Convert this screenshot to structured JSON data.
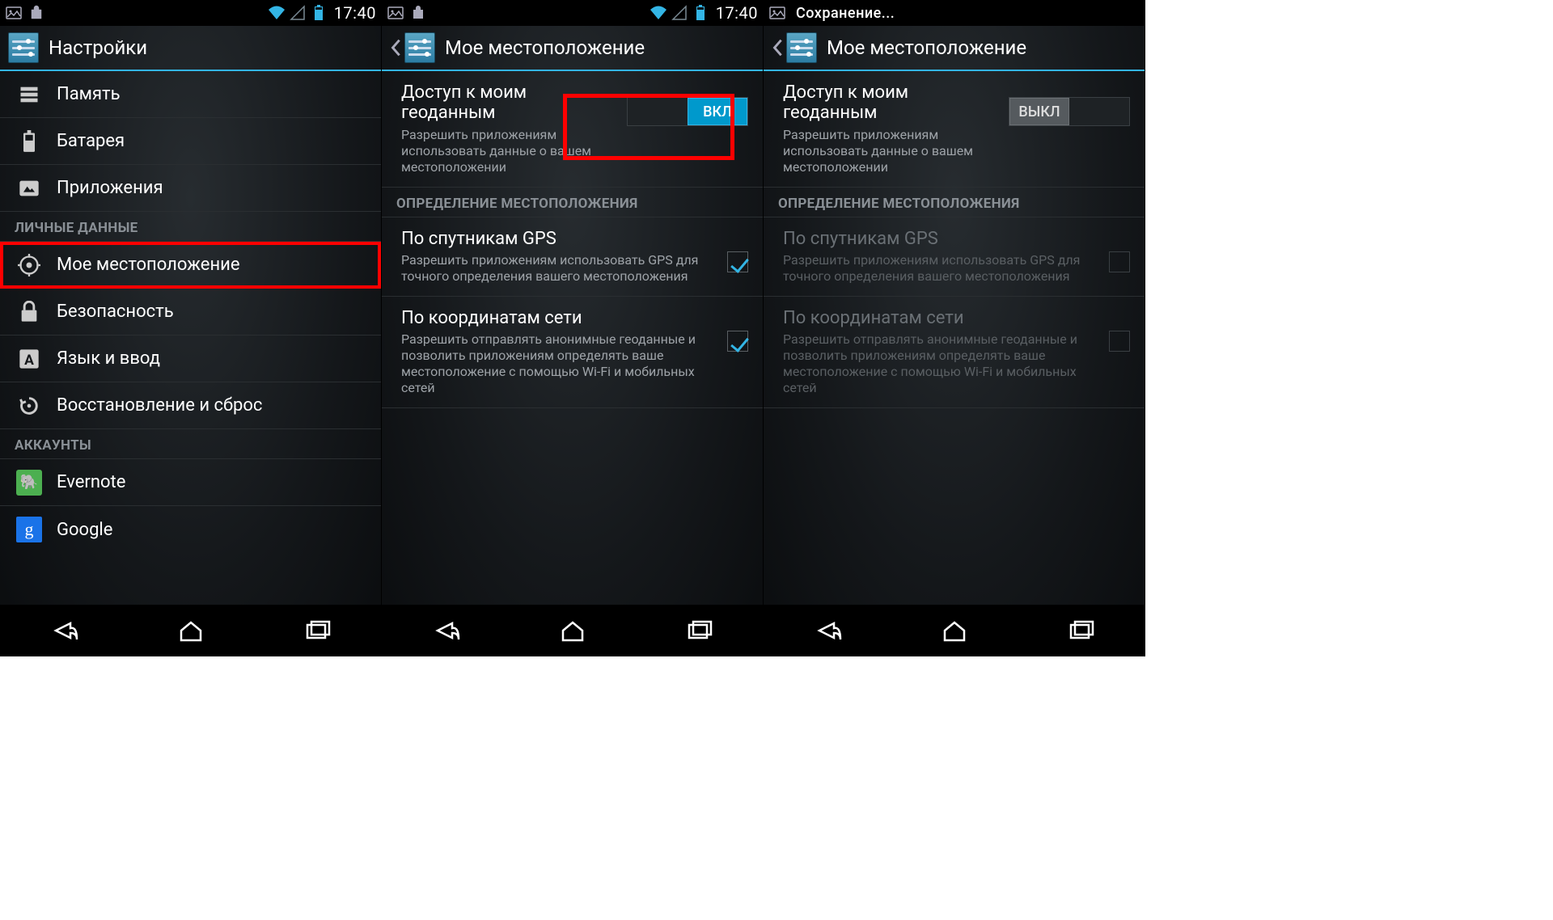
{
  "status": {
    "time": "17:40",
    "saving_text": "Сохранение..."
  },
  "screen1": {
    "title": "Настройки",
    "items": {
      "storage": "Память",
      "battery": "Батарея",
      "apps": "Приложения",
      "location": "Мое местоположение",
      "security": "Безопасность",
      "language": "Язык и ввод",
      "backup": "Восстановление и сброс",
      "evernote": "Evernote",
      "google": "Google"
    },
    "sections": {
      "personal": "ЛИЧНЫЕ ДАННЫЕ",
      "accounts": "АККАУНТЫ"
    }
  },
  "screen2": {
    "title": "Мое местоположение",
    "access_title": "Доступ к моим геоданным",
    "access_sub": "Разрешить приложениям использовать данные о вашем местоположении",
    "toggle_on_label": "ВКЛ",
    "section_sources": "ОПРЕДЕЛЕНИЕ МЕСТОПОЛОЖЕНИЯ",
    "gps_title": "По спутникам GPS",
    "gps_sub": "Разрешить приложениям использовать GPS для точного определения вашего местоположения",
    "net_title": "По координатам сети",
    "net_sub": "Разрешить отправлять анонимные геоданные и позволить приложениям определять ваше местоположение с помощью Wi-Fi и мобильных сетей"
  },
  "screen3": {
    "title": "Мое местоположение",
    "access_title": "Доступ к моим геоданным",
    "access_sub": "Разрешить приложениям использовать данные о вашем местоположении",
    "toggle_off_label": "ВЫКЛ",
    "section_sources": "ОПРЕДЕЛЕНИЕ МЕСТОПОЛОЖЕНИЯ",
    "gps_title": "По спутникам GPS",
    "gps_sub": "Разрешить приложениям использовать GPS для точного определения вашего местоположения",
    "net_title": "По координатам сети",
    "net_sub": "Разрешить отправлять анонимные геоданные и позволить приложениям определять ваше местоположение с помощью Wi-Fi и мобильных сетей"
  }
}
